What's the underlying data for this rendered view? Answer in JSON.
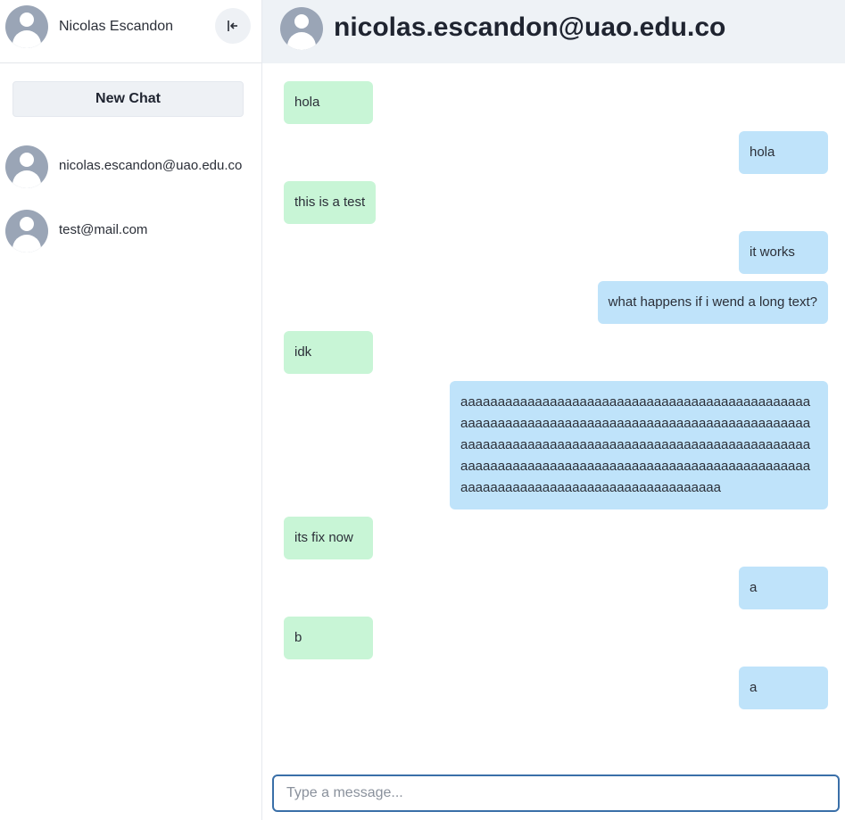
{
  "user": {
    "name": "Nicolas Escandon"
  },
  "sidebar": {
    "new_chat_label": "New Chat",
    "contacts": [
      {
        "label": "nicolas.escandon@uao.edu.co"
      },
      {
        "label": "test@mail.com"
      }
    ]
  },
  "chat": {
    "title": "nicolas.escandon@uao.edu.co",
    "messages": [
      {
        "side": "in",
        "text": "hola"
      },
      {
        "side": "out",
        "text": "hola"
      },
      {
        "side": "in",
        "text": "this is a test"
      },
      {
        "side": "out",
        "text": "it works"
      },
      {
        "side": "out",
        "text": "what happens if i wend a long text?"
      },
      {
        "side": "in",
        "text": "idk"
      },
      {
        "side": "out",
        "text": "aaaaaaaaaaaaaaaaaaaaaaaaaaaaaaaaaaaaaaaaaaaaaaaaaaaaaaaaaaaaaaaaaaaaaaaaaaaaaaaaaaaaaaaaaaaaaaaaaaaaaaaaaaaaaaaaaaaaaaaaaaaaaaaaaaaaaaaaaaaaaaaaaaaaaaaaaaaaaaaaaaaaaaaaaaaaaaaaaaaaaaaaaaaaaaaaaaaaaaaaaaaaaaaaaaaaaaaaaaaaaaa"
      },
      {
        "side": "in",
        "text": "its fix now"
      },
      {
        "side": "out",
        "text": "a"
      },
      {
        "side": "in",
        "text": "b"
      },
      {
        "side": "out",
        "text": "a"
      }
    ]
  },
  "composer": {
    "placeholder": "Type a message..."
  },
  "colors": {
    "incoming_bubble": "#c8f5d6",
    "outgoing_bubble": "#bfe3fa",
    "avatar": "#9aa5b6",
    "input_border": "#3a6fa8"
  },
  "icons": {
    "logout": "logout-icon",
    "avatar": "user-avatar-icon"
  }
}
